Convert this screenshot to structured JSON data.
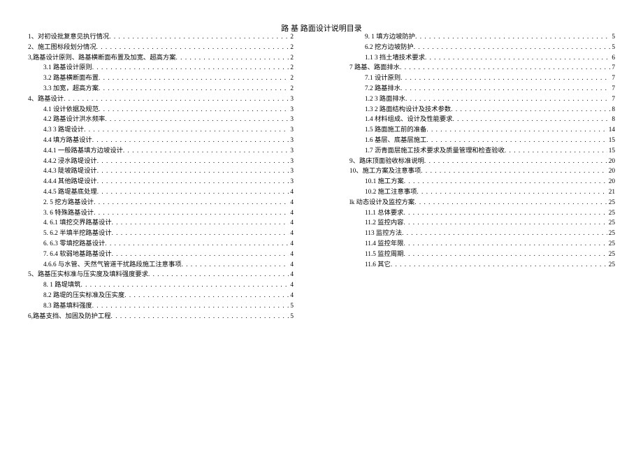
{
  "title": "路 基  路面设计说明目录",
  "col1": [
    {
      "label": "1、对初设批复意见执行情况",
      "page": "2",
      "indent": 0
    },
    {
      "label": "2、施工图标段划分情况",
      "page": "2",
      "indent": 0
    },
    {
      "label": "3,路基设计原则、路基横断面布置及加宽、超高方案",
      "page": "2",
      "indent": 0
    },
    {
      "label": "3.1    路基设计原则",
      "page": "2",
      "indent": 1
    },
    {
      "label": "3.2    路基横断面布置",
      "page": "2",
      "indent": 1
    },
    {
      "label": "3.3    加宽，超高方案",
      "page": "2",
      "indent": 1
    },
    {
      "label": "4、路基设计",
      "page": "3",
      "indent": 0
    },
    {
      "label": "4.1    设计依据及规范",
      "page": "3",
      "indent": 1
    },
    {
      "label": "4.2    路基设计洪水频率",
      "page": "3",
      "indent": 1
    },
    {
      "label": "4.3    3 路堤设计",
      "page": "3",
      "indent": 1
    },
    {
      "label": "4.4      填方路基设计",
      "page": "3",
      "indent": 1
    },
    {
      "label": "4.4.1    一般路基填方边坡设计",
      "page": "3",
      "indent": 1
    },
    {
      "label": "4.4.2 浸水路堤设计",
      "page": "3",
      "indent": 1
    },
    {
      "label": "4.4.3 陡坡路堤设计",
      "page": "3",
      "indent": 1
    },
    {
      "label": "4.4.4 其他路堤设计",
      "page": "3",
      "indent": 1
    },
    {
      "label": "4.4.5 路堤基底处理",
      "page": "4",
      "indent": 1
    },
    {
      "label": "2.    5 挖方路基设计",
      "page": "4",
      "indent": 1
    },
    {
      "label": "3.    6 特殊路基设计",
      "page": "4",
      "indent": 1
    },
    {
      "label": "4.    6.1 填挖交界路基设计",
      "page": "4",
      "indent": 1
    },
    {
      "label": "5.    6.2 半填半挖路基设计",
      "page": "4",
      "indent": 1
    },
    {
      "label": "6.    6.3 零填挖路基设计",
      "page": "4",
      "indent": 1
    },
    {
      "label": "7.    6.4 软弱地基路基设计",
      "page": "4",
      "indent": 1
    },
    {
      "label": "4.6.6 与水管、天然气管道干扰路段施工注意事项",
      "page": "4",
      "indent": 1
    },
    {
      "label": "5、路基压实标准与压实度及填料强度要求",
      "page": "4",
      "indent": 0
    },
    {
      "label": "8.    1 路堤填筑",
      "page": "4",
      "indent": 1
    },
    {
      "label": "8.2      路堤的压实标准及压实度",
      "page": "4",
      "indent": 1
    },
    {
      "label": "8.3      路基填料强度",
      "page": "5",
      "indent": 1
    },
    {
      "label": "6,路基支挡、加固及防护工程",
      "page": "5",
      "indent": 0
    }
  ],
  "col2": [
    {
      "label": "9.    1 填方边坡防护",
      "page": "5",
      "indent": 1
    },
    {
      "label": "6.2 挖方边坡防护",
      "page": "5",
      "indent": 1
    },
    {
      "label": "1.1    3 挡土墙技术要求",
      "page": "6",
      "indent": 1
    },
    {
      "label": "7 路基、路面排水",
      "page": "7",
      "indent": 0
    },
    {
      "label": "7.1    设计原则",
      "page": "7",
      "indent": 1
    },
    {
      "label": "7.2    路基排水",
      "page": "7",
      "indent": 1
    },
    {
      "label": "1.2    3 路面排水",
      "page": "7",
      "indent": 1
    },
    {
      "label": "1.3    2 路面结构设计及技术参数",
      "page": "8",
      "indent": 1
    },
    {
      "label": "1.4    材料组成、设计及性能要求",
      "page": "8",
      "indent": 1
    },
    {
      "label": "1.5    路面施工前的准备",
      "page": "14",
      "indent": 1
    },
    {
      "label": "1.6    基层、底基层施工",
      "page": "15",
      "indent": 1
    },
    {
      "label": "1.7    沥青面层施工技术要求及质量管理和检查验收",
      "page": "15",
      "indent": 1
    },
    {
      "label": "9、路床顶面验收标准说明",
      "page": "20",
      "indent": 0
    },
    {
      "label": "10、施工方案及注意事项",
      "page": "20",
      "indent": 0
    },
    {
      "label": "10.1    施工方案",
      "page": "20",
      "indent": 1
    },
    {
      "label": "10.2    施工注意事项",
      "page": "21",
      "indent": 1
    },
    {
      "label": "lk 动态设计及监控方案",
      "page": "25",
      "indent": 0
    },
    {
      "label": "11.1    总体要求",
      "page": "25",
      "indent": 1
    },
    {
      "label": "11.2    监控内容",
      "page": "25",
      "indent": 1
    },
    {
      "label": "113 监控方法",
      "page": "25",
      "indent": 1
    },
    {
      "label": "11.4    监控年限",
      "page": "25",
      "indent": 1
    },
    {
      "label": "11.5    监控周期",
      "page": "25",
      "indent": 1
    },
    {
      "label": "11.6    其它",
      "page": "25",
      "indent": 1
    }
  ]
}
